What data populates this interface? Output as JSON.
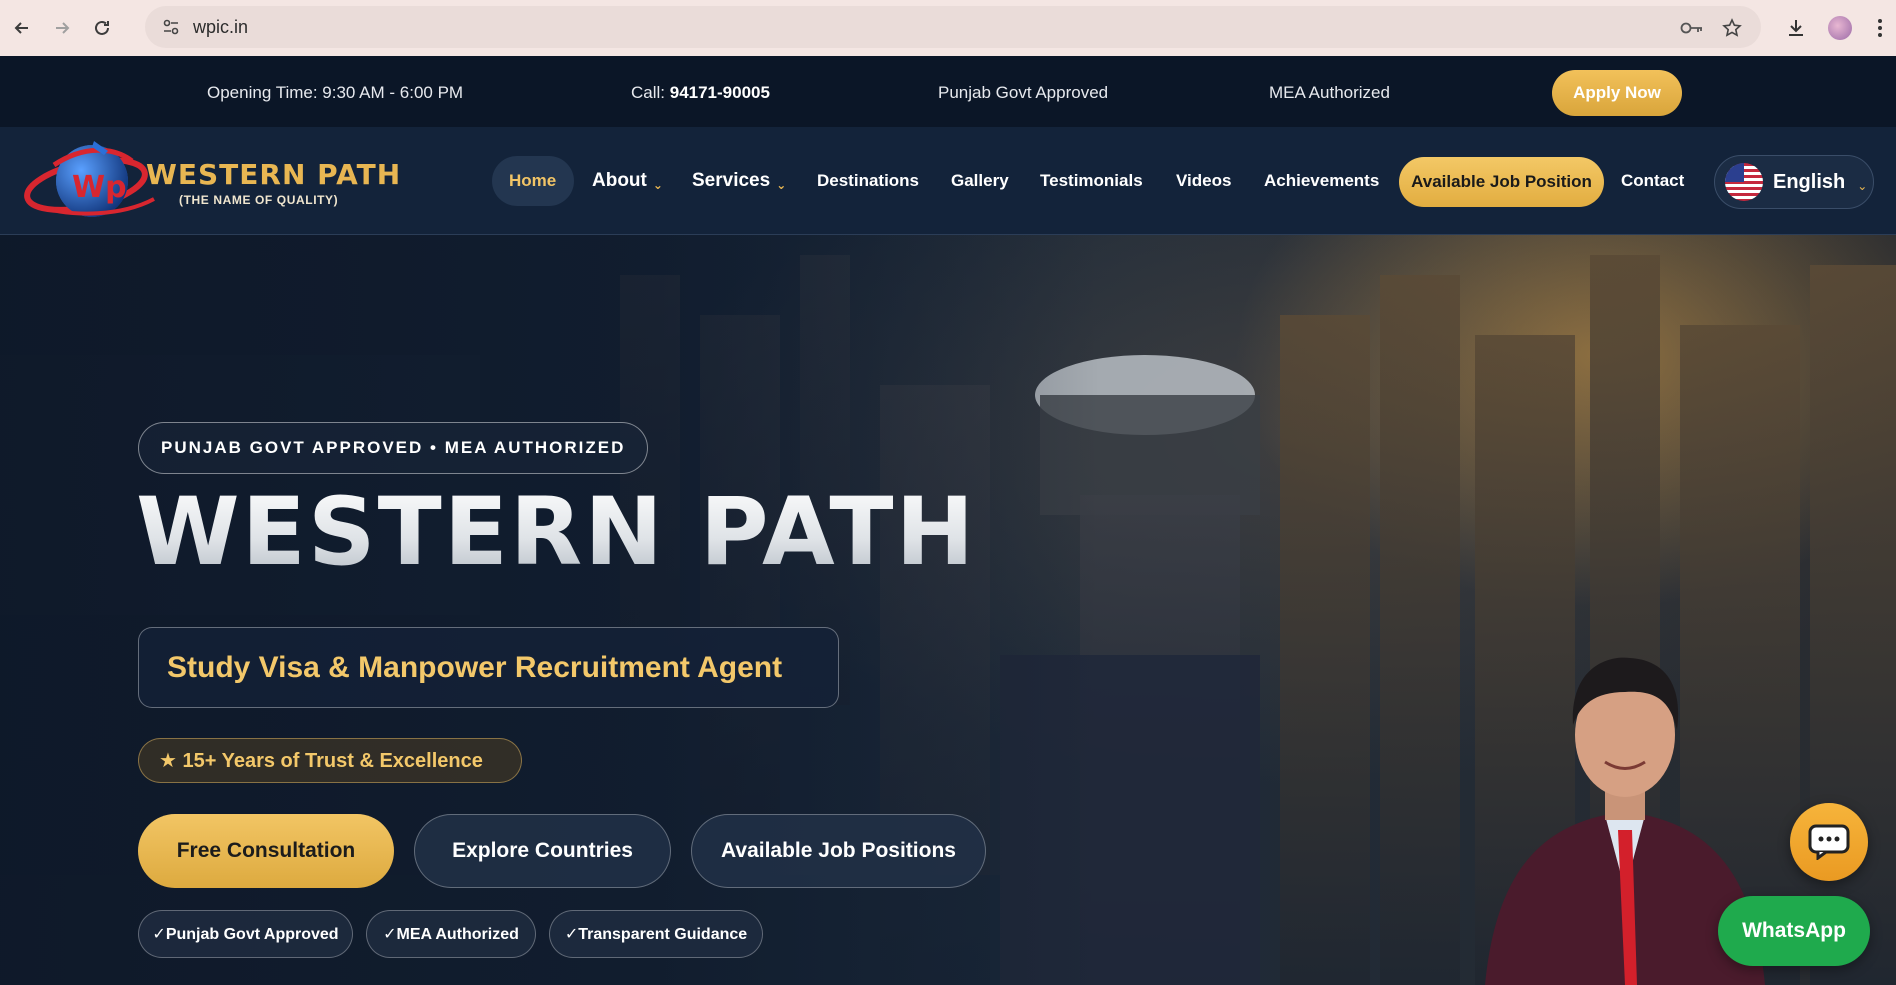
{
  "browser": {
    "url": "wpic.in"
  },
  "topbar": {
    "opening": "Opening Time: 9:30 AM - 6:00 PM",
    "call_label": "Call: ",
    "call_number": "94171-90005",
    "govt": "Punjab Govt Approved",
    "mea": "MEA Authorized",
    "apply": "Apply Now"
  },
  "logo": {
    "title": "WESTERN PATH",
    "subtitle": "(THE NAME OF QUALITY)",
    "mark": "Wp"
  },
  "nav": {
    "home": "Home",
    "about": "About",
    "services": "Services",
    "destinations": "Destinations",
    "gallery": "Gallery",
    "testimonials": "Testimonials",
    "videos": "Videos",
    "achievements": "Achievements",
    "jobs": "Available Job Position",
    "contact": "Contact",
    "language": "English"
  },
  "hero": {
    "badge": "PUNJAB GOVT APPROVED • MEA AUTHORIZED",
    "title": "WESTERN PATH",
    "tagline": "Study Visa & Manpower Recruitment Agent",
    "years": "★ 15+ Years of Trust  &  Excellence",
    "cta_free": "Free Consultation",
    "cta_explore": "Explore Countries",
    "cta_jobs": "Available Job Positions",
    "chips": [
      "✓Punjab Govt Approved",
      "✓MEA Authorized",
      "✓Transparent Guidance"
    ]
  },
  "floating": {
    "whatsapp": "WhatsApp"
  },
  "colors": {
    "accent_gold": "#f2c15a",
    "navy": "#13233a",
    "whatsapp_green": "#1faa4d"
  }
}
